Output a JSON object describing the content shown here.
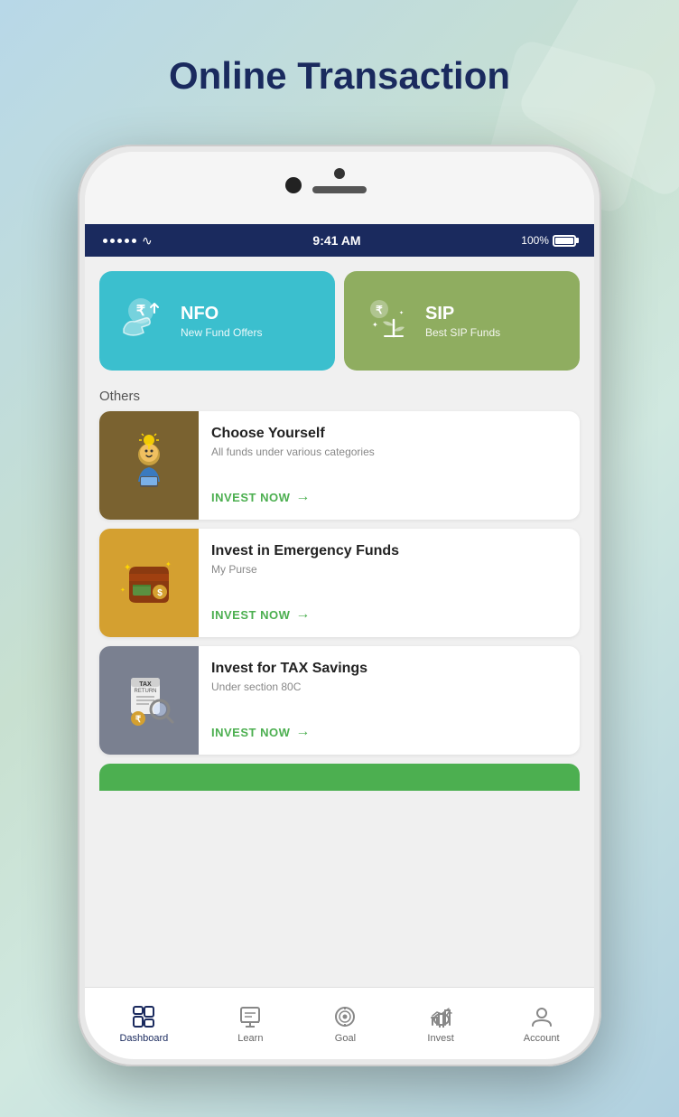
{
  "page": {
    "title": "Online Transaction",
    "background": "linear-gradient"
  },
  "statusBar": {
    "time": "9:41 AM",
    "battery": "100%"
  },
  "cards": [
    {
      "id": "nfo",
      "title": "NFO",
      "subtitle": "New Fund Offers",
      "color": "#3bbfce"
    },
    {
      "id": "sip",
      "title": "SIP",
      "subtitle": "Best SIP Funds",
      "color": "#8fad60"
    }
  ],
  "othersLabel": "Others",
  "listItems": [
    {
      "id": "choose-yourself",
      "title": "Choose Yourself",
      "subtitle": "All funds under various categories",
      "cta": "INVEST NOW"
    },
    {
      "id": "emergency-funds",
      "title": "Invest in Emergency Funds",
      "subtitle": "My Purse",
      "cta": "INVEST NOW"
    },
    {
      "id": "tax-savings",
      "title": "Invest for TAX Savings",
      "subtitle": "Under section 80C",
      "cta": "INVEST NOW"
    }
  ],
  "bottomNav": [
    {
      "id": "dashboard",
      "label": "Dashboard",
      "active": true
    },
    {
      "id": "learn",
      "label": "Learn",
      "active": false
    },
    {
      "id": "goal",
      "label": "Goal",
      "active": false
    },
    {
      "id": "invest",
      "label": "Invest",
      "active": false
    },
    {
      "id": "account",
      "label": "Account",
      "active": false
    }
  ]
}
